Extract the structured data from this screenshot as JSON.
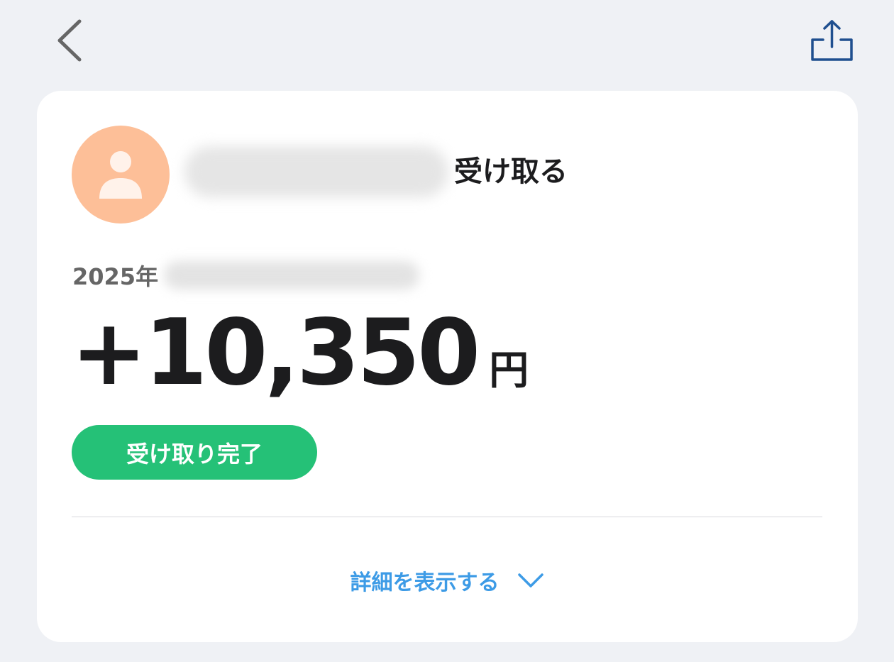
{
  "nav": {
    "back_icon": "chevron-left-icon",
    "share_icon": "share-icon"
  },
  "card": {
    "avatar_icon": "person-icon",
    "receive_label": "受け取る",
    "date_year": "2025年",
    "amount": "+10,350",
    "currency": "円",
    "status": "受け取り完了",
    "detail_label": "詳細を表示する",
    "detail_icon": "chevron-down-icon"
  },
  "colors": {
    "background": "#eff1f5",
    "card": "#ffffff",
    "avatar": "#fdbf98",
    "status_badge": "#25c177",
    "link": "#3d9be6",
    "share_icon": "#1f4f8f",
    "text": "#1c1c1e"
  }
}
